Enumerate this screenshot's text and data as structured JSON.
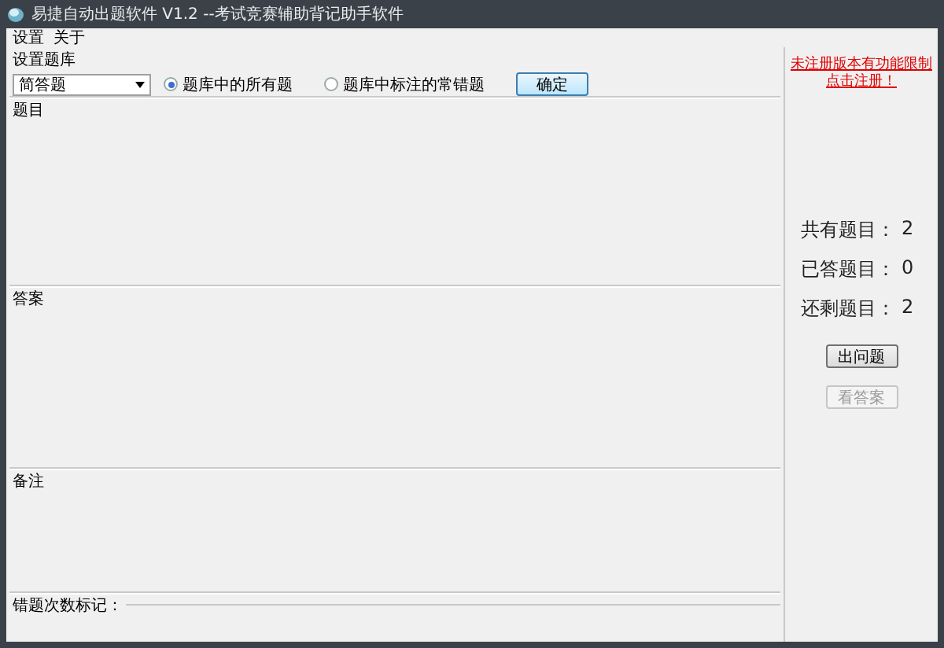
{
  "window": {
    "title": "易捷自动出题软件 V1.2   --考试竞赛辅助背记助手软件"
  },
  "menu": [
    {
      "label": "设置"
    },
    {
      "label": "关于"
    }
  ],
  "question_bank": {
    "title": "设置题库",
    "dropdown": {
      "value": "简答题"
    },
    "options": [
      {
        "label": "题库中的所有题",
        "selected": true
      },
      {
        "label": "题库中标注的常错题",
        "selected": false
      }
    ],
    "confirm_button": "确定"
  },
  "sections": [
    {
      "title": "题目"
    },
    {
      "title": "答案"
    },
    {
      "title": "备注"
    }
  ],
  "error_mark": {
    "title": "错题次数标记："
  },
  "sidebar": {
    "register_link": [
      "未注册版本有功能限制",
      "点击注册！"
    ],
    "stats": [
      {
        "label": "共有题目：",
        "value": "2"
      },
      {
        "label": "已答题目：",
        "value": "0"
      },
      {
        "label": "还剩题目：",
        "value": "2"
      }
    ],
    "buttons": [
      {
        "label": "出问题",
        "disabled": false
      },
      {
        "label": "看答案",
        "disabled": true
      }
    ]
  }
}
